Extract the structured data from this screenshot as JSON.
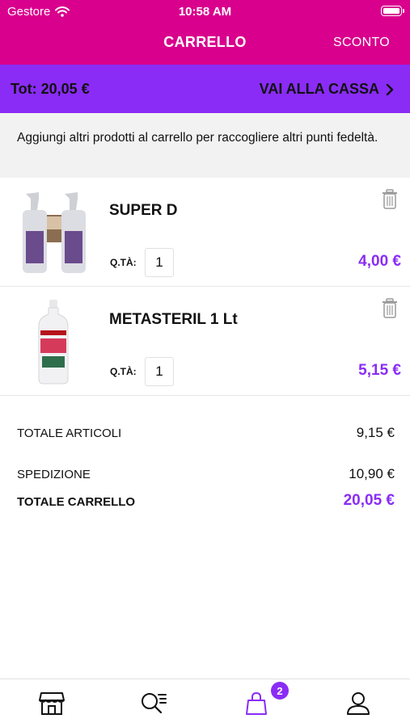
{
  "status_bar": {
    "carrier": "Gestore",
    "time": "10:58 AM"
  },
  "nav": {
    "title": "CARRELLO",
    "right_action": "SCONTO"
  },
  "checkout_bar": {
    "total": "Tot: 20,05 €",
    "action": "VAI ALLA CASSA"
  },
  "notice": "Aggiungi altri prodotti al carrello per raccogliere altri punti fedeltà.",
  "items": [
    {
      "name": "SUPER D",
      "qty_label": "Q.TÀ:",
      "qty": "1",
      "price": "4,00 €"
    },
    {
      "name": "METASTERIL 1 Lt",
      "qty_label": "Q.TÀ:",
      "qty": "1",
      "price": "5,15 €"
    }
  ],
  "totals": {
    "articles_label": "TOTALE ARTICOLI",
    "articles_value": "9,15 €",
    "shipping_label": "SPEDIZIONE",
    "shipping_value": "10,90 €",
    "cart_label": "TOTALE CARRELLO",
    "cart_value": "20,05 €"
  },
  "tabbar": {
    "items": [
      {
        "icon": "store-icon"
      },
      {
        "icon": "search-list-icon"
      },
      {
        "icon": "cart-bag-icon",
        "badge": "2"
      },
      {
        "icon": "user-icon"
      }
    ]
  },
  "colors": {
    "header": "#d9008d",
    "accent": "#8a2cf5",
    "notice_bg": "#f2f2f2"
  }
}
